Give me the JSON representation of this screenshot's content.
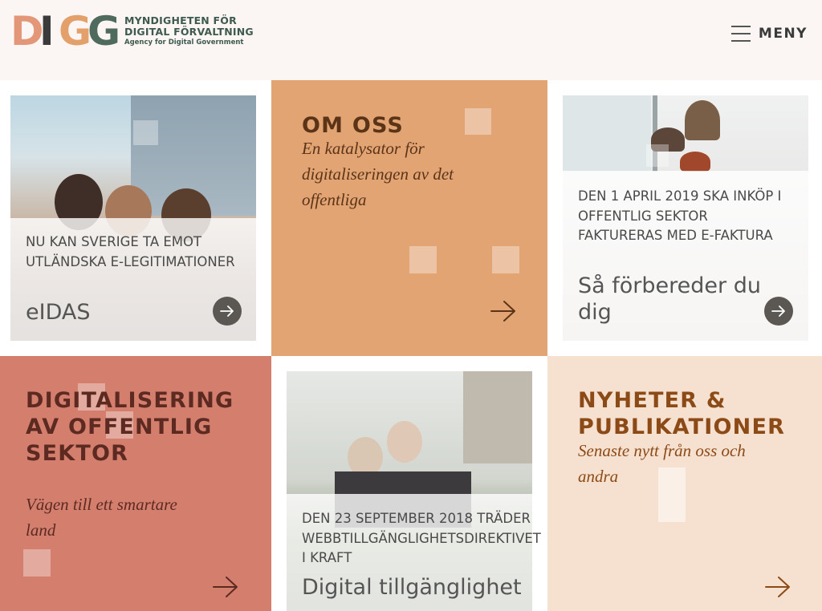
{
  "header": {
    "logo_letters": [
      "D",
      "I",
      "G",
      "G"
    ],
    "logo_line1": "MYNDIGHETEN FÖR",
    "logo_line2": "DIGITAL FÖRVALTNING",
    "logo_line3": "Agency for Digital Government",
    "menu_label": "MENY"
  },
  "tiles": {
    "eidas": {
      "kicker": "NU KAN SVERIGE TA EMOT UTLÄNDSKA E-LEGITIMATIONER",
      "title": "eIDAS"
    },
    "om_oss": {
      "heading": "OM OSS",
      "subtitle": "En katalysator för digitaliseringen av det offentliga"
    },
    "efaktura": {
      "kicker": "DEN 1 APRIL 2019 SKA INKÖP I OFFENTLIG SEKTOR FAKTURERAS MED E-FAKTURA",
      "title": "Så förbereder du dig"
    },
    "digitalisering": {
      "heading": "DIGITALISERING AV OFFENTLIG SEKTOR",
      "subtitle": "Vägen till ett smartare land"
    },
    "tillganglighet": {
      "kicker": "DEN 23 SEPTEMBER 2018 TRÄDER WEBBTILLGÄNGLIGHETSDIREKTIVET I KRAFT",
      "title": "Digital tillgänglighet"
    },
    "nyheter": {
      "heading": "NYHETER & PUBLIKATIONER",
      "subtitle": "Senaste nytt från oss och andra"
    }
  },
  "colors": {
    "header_bg": "#fbf6f3",
    "orange": "#e2a473",
    "terracotta": "#d47f6e",
    "peach": "#f6e0d0",
    "heading_dark": "#5b3418",
    "heading_dark_red": "#5d2a22",
    "heading_brown": "#8c4a16",
    "logo_green": "#3f5a50"
  },
  "icons": [
    "menu-icon",
    "arrow-right-icon"
  ]
}
